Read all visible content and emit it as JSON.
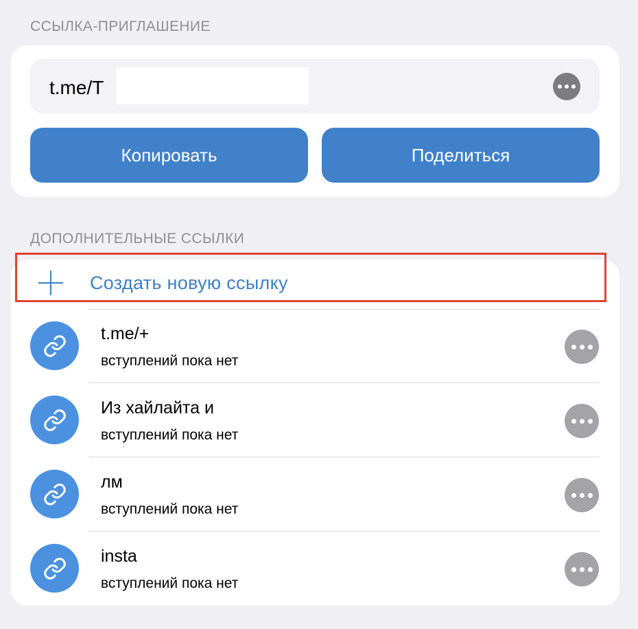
{
  "invite": {
    "header": "ССЫЛКА-ПРИГЛАШЕНИЕ",
    "link": "t.me/T",
    "copy_label": "Копировать",
    "share_label": "Поделиться"
  },
  "extra": {
    "header": "ДОПОЛНИТЕЛЬНЫЕ ССЫЛКИ",
    "create_label": "Создать новую ссылку",
    "links": [
      {
        "title": "t.me/+",
        "subtitle": "вступлений пока нет"
      },
      {
        "title": "Из хайлайта и",
        "subtitle": "вступлений пока нет"
      },
      {
        "title": "лм",
        "subtitle": "вступлений пока нет"
      },
      {
        "title": "insta",
        "subtitle": "вступлений пока нет"
      }
    ]
  },
  "icons": {
    "more": "more-horizontal-icon",
    "link": "link-icon",
    "plus": "plus-icon"
  },
  "colors": {
    "accent": "#4181c9",
    "avatar": "#4b91e0",
    "highlight": "#e0432f",
    "background": "#efeff4"
  }
}
